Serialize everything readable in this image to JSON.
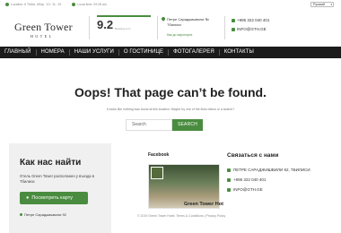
{
  "topbar": {
    "location": "Location: 6 Tbilisi, 6Sep, '10: '11; '10",
    "local_time": "Local time: 09:28 am",
    "lang": "Русский"
  },
  "header": {
    "logo": "Green Tower",
    "logo_sub": "HOTEL",
    "rating": "9.2",
    "rating_sub": "Booking.com",
    "address_line1": "Петре Сараджишвили №",
    "address_line2": "Тбилиси",
    "address_link": "Как до аэропорта",
    "phone": "+995 322 040 401",
    "email": "INFO@GTH.GE"
  },
  "nav": [
    "ГЛАВНЫЙ",
    "НОМЕРА",
    "НАШИ УСЛУГИ",
    "О ГОСТИНИЦЕ",
    "ФОТОГАЛЕРЕЯ",
    "КОНТАКТЫ"
  ],
  "main": {
    "title": "Oops! That page can’t be found.",
    "subtitle": "It looks like nothing was found at this location. Maybe try one of the links below or a search?",
    "search_placeholder": "Search",
    "search_button": "SEARCH"
  },
  "find_us": {
    "title": "Как нас найти",
    "text": "Отель Green Tower расположен у въезда в Тбилиси",
    "button": "Посмотреть карту",
    "address": "Петре Сараджишвили 92"
  },
  "facebook": {
    "title": "Facebook",
    "page_name": "Green Tower Hot"
  },
  "contacts": {
    "title": "Связаться с нами",
    "address": "ПЕТРЕ САРАДЖИШВИЛИ 92, ТБИЛИСИ",
    "phone": "+995 322 040 401",
    "email": "INFO@GTH.GE"
  },
  "footer": {
    "text": "© 2019 Green Tower Hotel. Terms & Conditions | Privacy Policy"
  },
  "colors": {
    "accent": "#4a8c3f",
    "nav_bg": "#1b1b1b"
  }
}
